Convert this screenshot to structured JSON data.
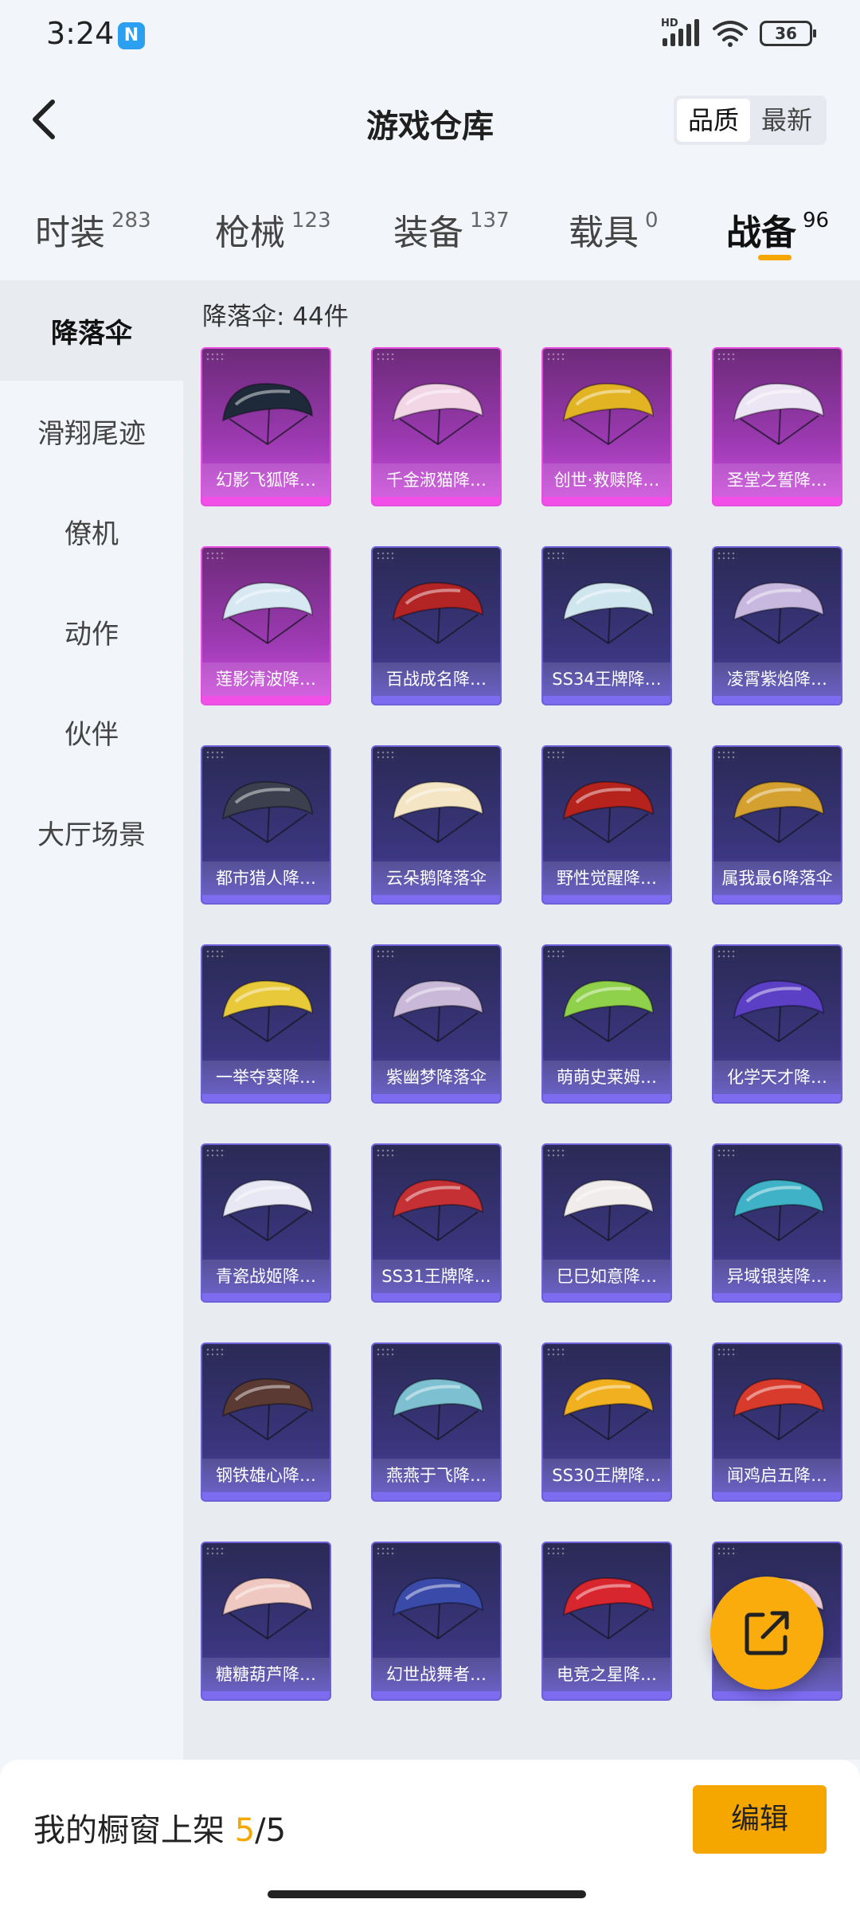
{
  "status_bar": {
    "time": "3:24",
    "nfc_icon": "nfc-icon",
    "signal_icon": "signal-icon",
    "wifi_icon": "wifi-icon",
    "battery_level": "36"
  },
  "header": {
    "title": "游戏仓库",
    "sort_options": [
      "品质",
      "最新"
    ],
    "sort_selected": "品质"
  },
  "tabs": [
    {
      "label": "时装",
      "count": "283"
    },
    {
      "label": "枪械",
      "count": "123"
    },
    {
      "label": "装备",
      "count": "137"
    },
    {
      "label": "载具",
      "count": "0"
    },
    {
      "label": "战备",
      "count": "96",
      "active": true
    }
  ],
  "sidebar": {
    "items": [
      {
        "label": "降落伞",
        "active": true
      },
      {
        "label": "滑翔尾迹"
      },
      {
        "label": "僚机"
      },
      {
        "label": "动作"
      },
      {
        "label": "伙伴"
      },
      {
        "label": "大厅场景"
      }
    ]
  },
  "content": {
    "heading": "降落伞: 44件",
    "items": [
      {
        "label": "幻影飞狐降…",
        "rarity": "legendary",
        "color": "#1e2a3a"
      },
      {
        "label": "千金淑猫降…",
        "rarity": "legendary",
        "color": "#f3d6e6"
      },
      {
        "label": "创世·救赎降…",
        "rarity": "legendary",
        "color": "#e2b323"
      },
      {
        "label": "圣堂之誓降…",
        "rarity": "legendary",
        "color": "#ece6f4"
      },
      {
        "label": "莲影清波降…",
        "rarity": "legendary",
        "color": "#d7e8f2"
      },
      {
        "label": "百战成名降…",
        "rarity": "epic",
        "color": "#b32424"
      },
      {
        "label": "SS34王牌降…",
        "rarity": "epic",
        "color": "#cfe6ee"
      },
      {
        "label": "凌霄紫焰降…",
        "rarity": "epic",
        "color": "#c8b8e0"
      },
      {
        "label": "都市猎人降…",
        "rarity": "epic",
        "color": "#3b3f4e"
      },
      {
        "label": "云朵鹅降落伞",
        "rarity": "epic",
        "color": "#f4e6c4"
      },
      {
        "label": "野性觉醒降…",
        "rarity": "epic",
        "color": "#b5231c"
      },
      {
        "label": "属我最6降落伞",
        "rarity": "epic",
        "color": "#d4a030"
      },
      {
        "label": "一举夺葵降…",
        "rarity": "epic",
        "color": "#e8c93a"
      },
      {
        "label": "紫幽梦降落伞",
        "rarity": "epic",
        "color": "#c9b8d8"
      },
      {
        "label": "萌萌史莱姆…",
        "rarity": "epic",
        "color": "#8fd14b"
      },
      {
        "label": "化学天才降…",
        "rarity": "epic",
        "color": "#5b3fc4"
      },
      {
        "label": "青瓷战姬降…",
        "rarity": "epic",
        "color": "#e7e8f4"
      },
      {
        "label": "SS31王牌降…",
        "rarity": "epic",
        "color": "#c43033"
      },
      {
        "label": "巳巳如意降…",
        "rarity": "epic",
        "color": "#f1ecec"
      },
      {
        "label": "异域银装降…",
        "rarity": "epic",
        "color": "#3fb2c7"
      },
      {
        "label": "钢铁雄心降…",
        "rarity": "epic",
        "color": "#5a3a32"
      },
      {
        "label": "燕燕于飞降…",
        "rarity": "epic",
        "color": "#7cc0d2"
      },
      {
        "label": "SS30王牌降…",
        "rarity": "epic",
        "color": "#f0b020"
      },
      {
        "label": "闻鸡启五降…",
        "rarity": "epic",
        "color": "#d83b2b"
      },
      {
        "label": "糖糖葫芦降…",
        "rarity": "epic",
        "color": "#f0c8c2"
      },
      {
        "label": "幻世战舞者…",
        "rarity": "epic",
        "color": "#3a4aa8"
      },
      {
        "label": "电竞之星降…",
        "rarity": "epic",
        "color": "#d8262f"
      },
      {
        "label": "",
        "rarity": "epic",
        "color": "#f4d2de"
      }
    ]
  },
  "fab": {
    "icon": "share-external-icon"
  },
  "bottom_bar": {
    "showcase_label": "我的橱窗上架",
    "showcase_current": "5",
    "showcase_sep": "/",
    "showcase_total": "5",
    "edit_label": "编辑"
  }
}
